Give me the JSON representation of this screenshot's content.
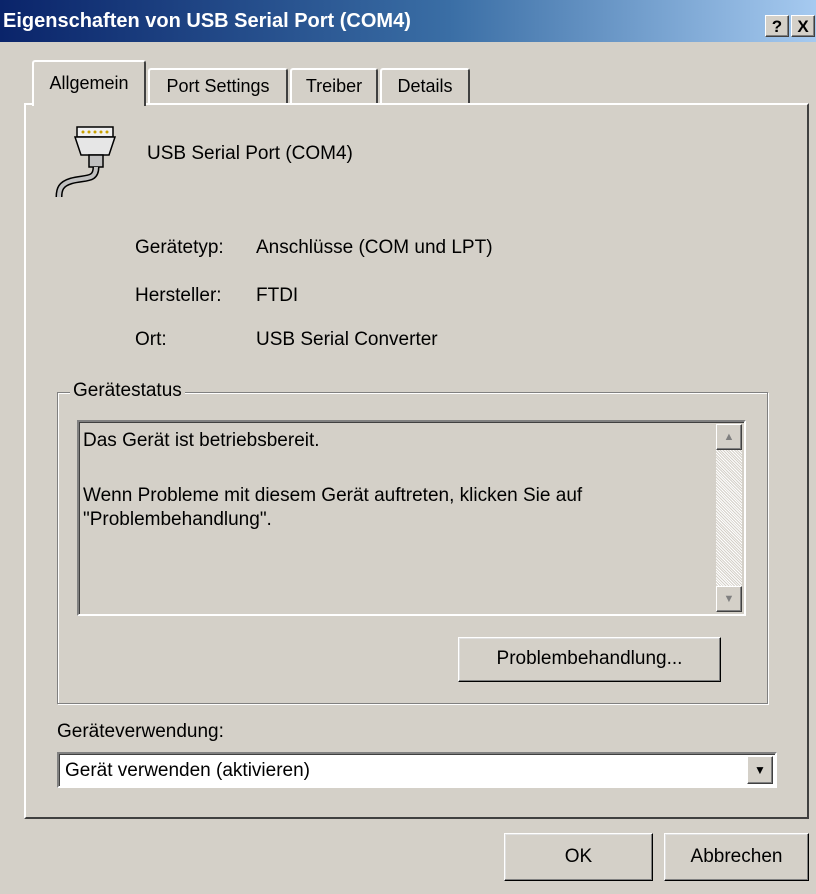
{
  "window": {
    "title": "Eigenschaften von USB Serial Port (COM4)",
    "help_label": "?",
    "close_label": "X"
  },
  "tabs": [
    {
      "label": "Allgemein",
      "active": true
    },
    {
      "label": "Port Settings",
      "active": false
    },
    {
      "label": "Treiber",
      "active": false
    },
    {
      "label": "Details",
      "active": false
    }
  ],
  "device": {
    "name": "USB Serial Port (COM4)",
    "icon": "serial-port-connector-icon",
    "properties": [
      {
        "label": "Gerätetyp:",
        "value": "Anschlüsse (COM und LPT)"
      },
      {
        "label": "Hersteller:",
        "value": "FTDI"
      },
      {
        "label": "Ort:",
        "value": "USB Serial Converter"
      }
    ]
  },
  "status": {
    "group_label": "Gerätestatus",
    "line1": "Das Gerät ist betriebsbereit.",
    "line2": "Wenn Probleme mit diesem Gerät auftreten, klicken Sie auf \"Problembehandlung\".",
    "troubleshoot_label": "Problembehandlung..."
  },
  "usage": {
    "label": "Geräteverwendung:",
    "selected": "Gerät verwenden (aktivieren)"
  },
  "footer": {
    "ok_label": "OK",
    "cancel_label": "Abbrechen"
  },
  "colors": {
    "titlebar_start": "#0a246a",
    "titlebar_end": "#a6caf0",
    "face": "#d4d0c8"
  }
}
